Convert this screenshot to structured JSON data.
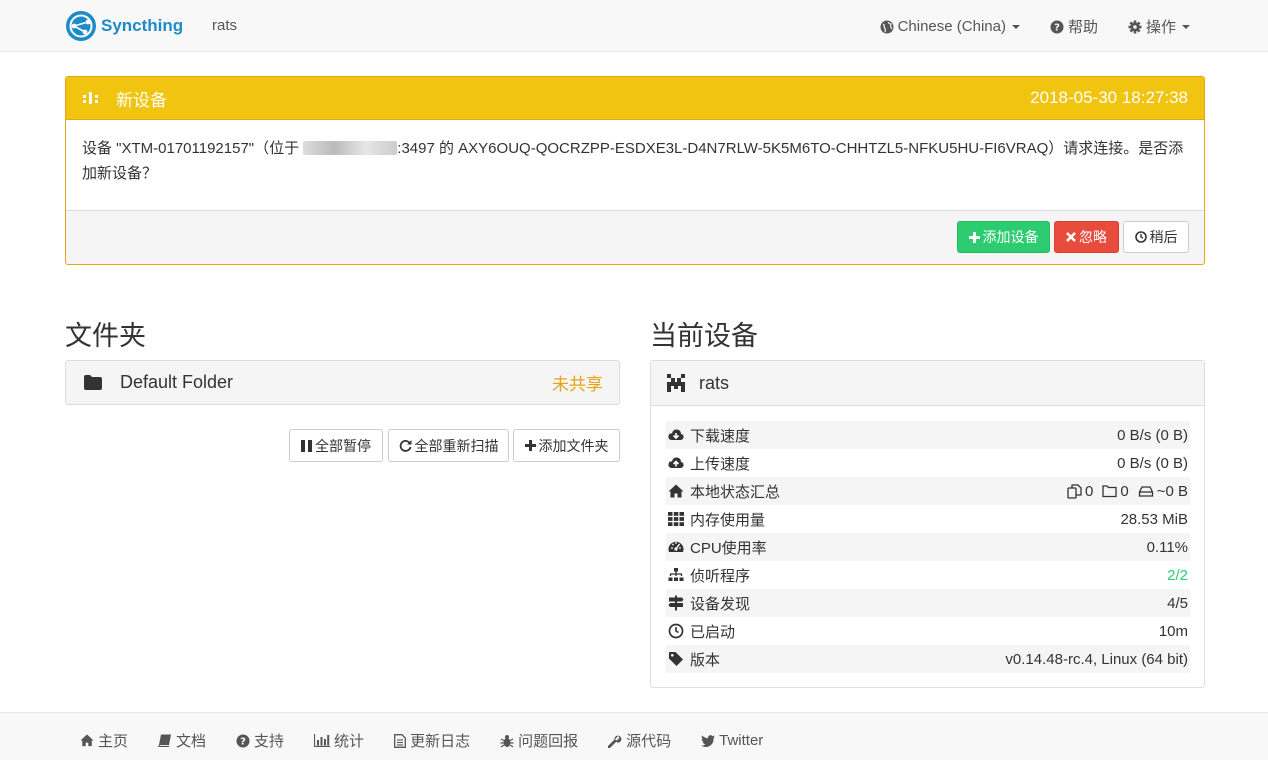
{
  "navbar": {
    "brand": "Syncthing",
    "device_name": "rats",
    "language": "Chinese (China)",
    "help": "帮助",
    "actions": "操作"
  },
  "notice": {
    "title": "新设备",
    "timestamp": "2018-05-30 18:27:38",
    "message_part1": "设备 \"XTM-01701192157\"（位于 ",
    "message_part2": ":3497 的 AXY6OUQ-QOCRZPP-ESDXE3L-D4N7RLW-5K5M6TO-CHHTZL5-NFKU5HU-FI6VRAQ）请求连接。是否添加新设备？",
    "add_label": "添加设备",
    "ignore_label": "忽略",
    "later_label": "稍后"
  },
  "folders": {
    "title": "文件夹",
    "items": [
      {
        "name": "Default Folder",
        "status": "未共享"
      }
    ],
    "pause_all": "全部暂停",
    "rescan_all": "全部重新扫描",
    "add_folder": "添加文件夹"
  },
  "this_device": {
    "title": "当前设备",
    "name": "rats",
    "stats": {
      "download": {
        "label": "下载速度",
        "value": "0 B/s (0 B)"
      },
      "upload": {
        "label": "上传速度",
        "value": "0 B/s (0 B)"
      },
      "local_state": {
        "label": "本地状态汇总",
        "files": "0",
        "dirs": "0",
        "size": "~0 B"
      },
      "ram": {
        "label": "内存使用量",
        "value": "28.53 MiB"
      },
      "cpu": {
        "label": "CPU使用率",
        "value": "0.11%"
      },
      "listeners": {
        "label": "侦听程序",
        "value": "2/2"
      },
      "discovery": {
        "label": "设备发现",
        "value": "4/5"
      },
      "uptime": {
        "label": "已启动",
        "value": "10m"
      },
      "version": {
        "label": "版本",
        "value": "v0.14.48-rc.4, Linux (64 bit)"
      }
    }
  },
  "footer": {
    "home": "主页",
    "docs": "文档",
    "support": "支持",
    "stats": "统计",
    "changelog": "更新日志",
    "bugs": "问题回报",
    "source": "源代码",
    "twitter": "Twitter"
  },
  "colors": {
    "brand": "#1d8bc8",
    "notice_header": "#f0c40f",
    "success": "#2ecc71",
    "danger": "#e74c3c",
    "warning_text": "#e8a316"
  }
}
